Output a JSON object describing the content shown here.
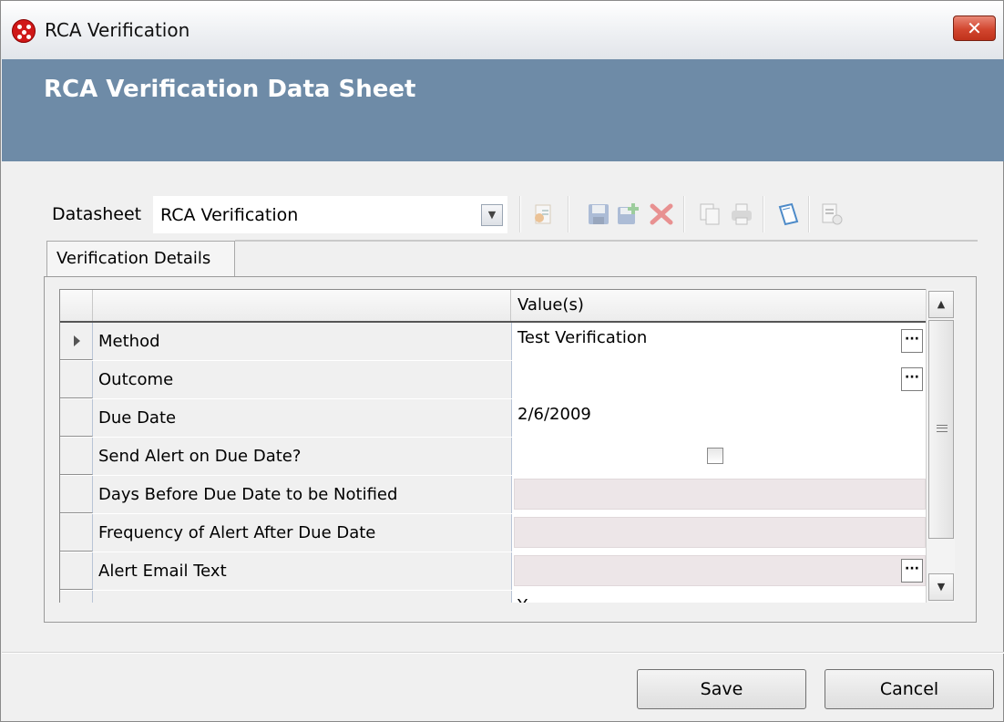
{
  "window": {
    "title": "RCA Verification",
    "close_label": "✕"
  },
  "header": {
    "title": "RCA Verification Data Sheet"
  },
  "datasheet": {
    "label": "Datasheet",
    "selected": "RCA Verification"
  },
  "toolbar": {
    "icons": [
      "new-record-icon",
      "save-icon",
      "save-and-new-icon",
      "delete-icon",
      "copy-icon",
      "print-icon",
      "reference-document-icon",
      "associated-pages-icon"
    ]
  },
  "tabs": [
    {
      "label": "Verification Details"
    }
  ],
  "grid": {
    "value_header": "Value(s)",
    "rows": [
      {
        "field": "Method",
        "value": "Test Verification"
      },
      {
        "field": "Outcome",
        "value": ""
      },
      {
        "field": "Due Date",
        "value": "2/6/2009"
      },
      {
        "field": "Send Alert on Due Date?",
        "value": ""
      },
      {
        "field": "Days Before Due Date to be Notified",
        "value": ""
      },
      {
        "field": "Frequency of Alert After Due Date",
        "value": ""
      },
      {
        "field": "Alert Email Text",
        "value": ""
      },
      {
        "field": "",
        "value": "Y"
      }
    ],
    "ellipsis_label": "···"
  },
  "footer": {
    "save_label": "Save",
    "cancel_label": "Cancel"
  },
  "colors": {
    "header_band": "#6e8ba7",
    "disabled_cell": "#ede6e8",
    "close_button": "#c8432c"
  }
}
